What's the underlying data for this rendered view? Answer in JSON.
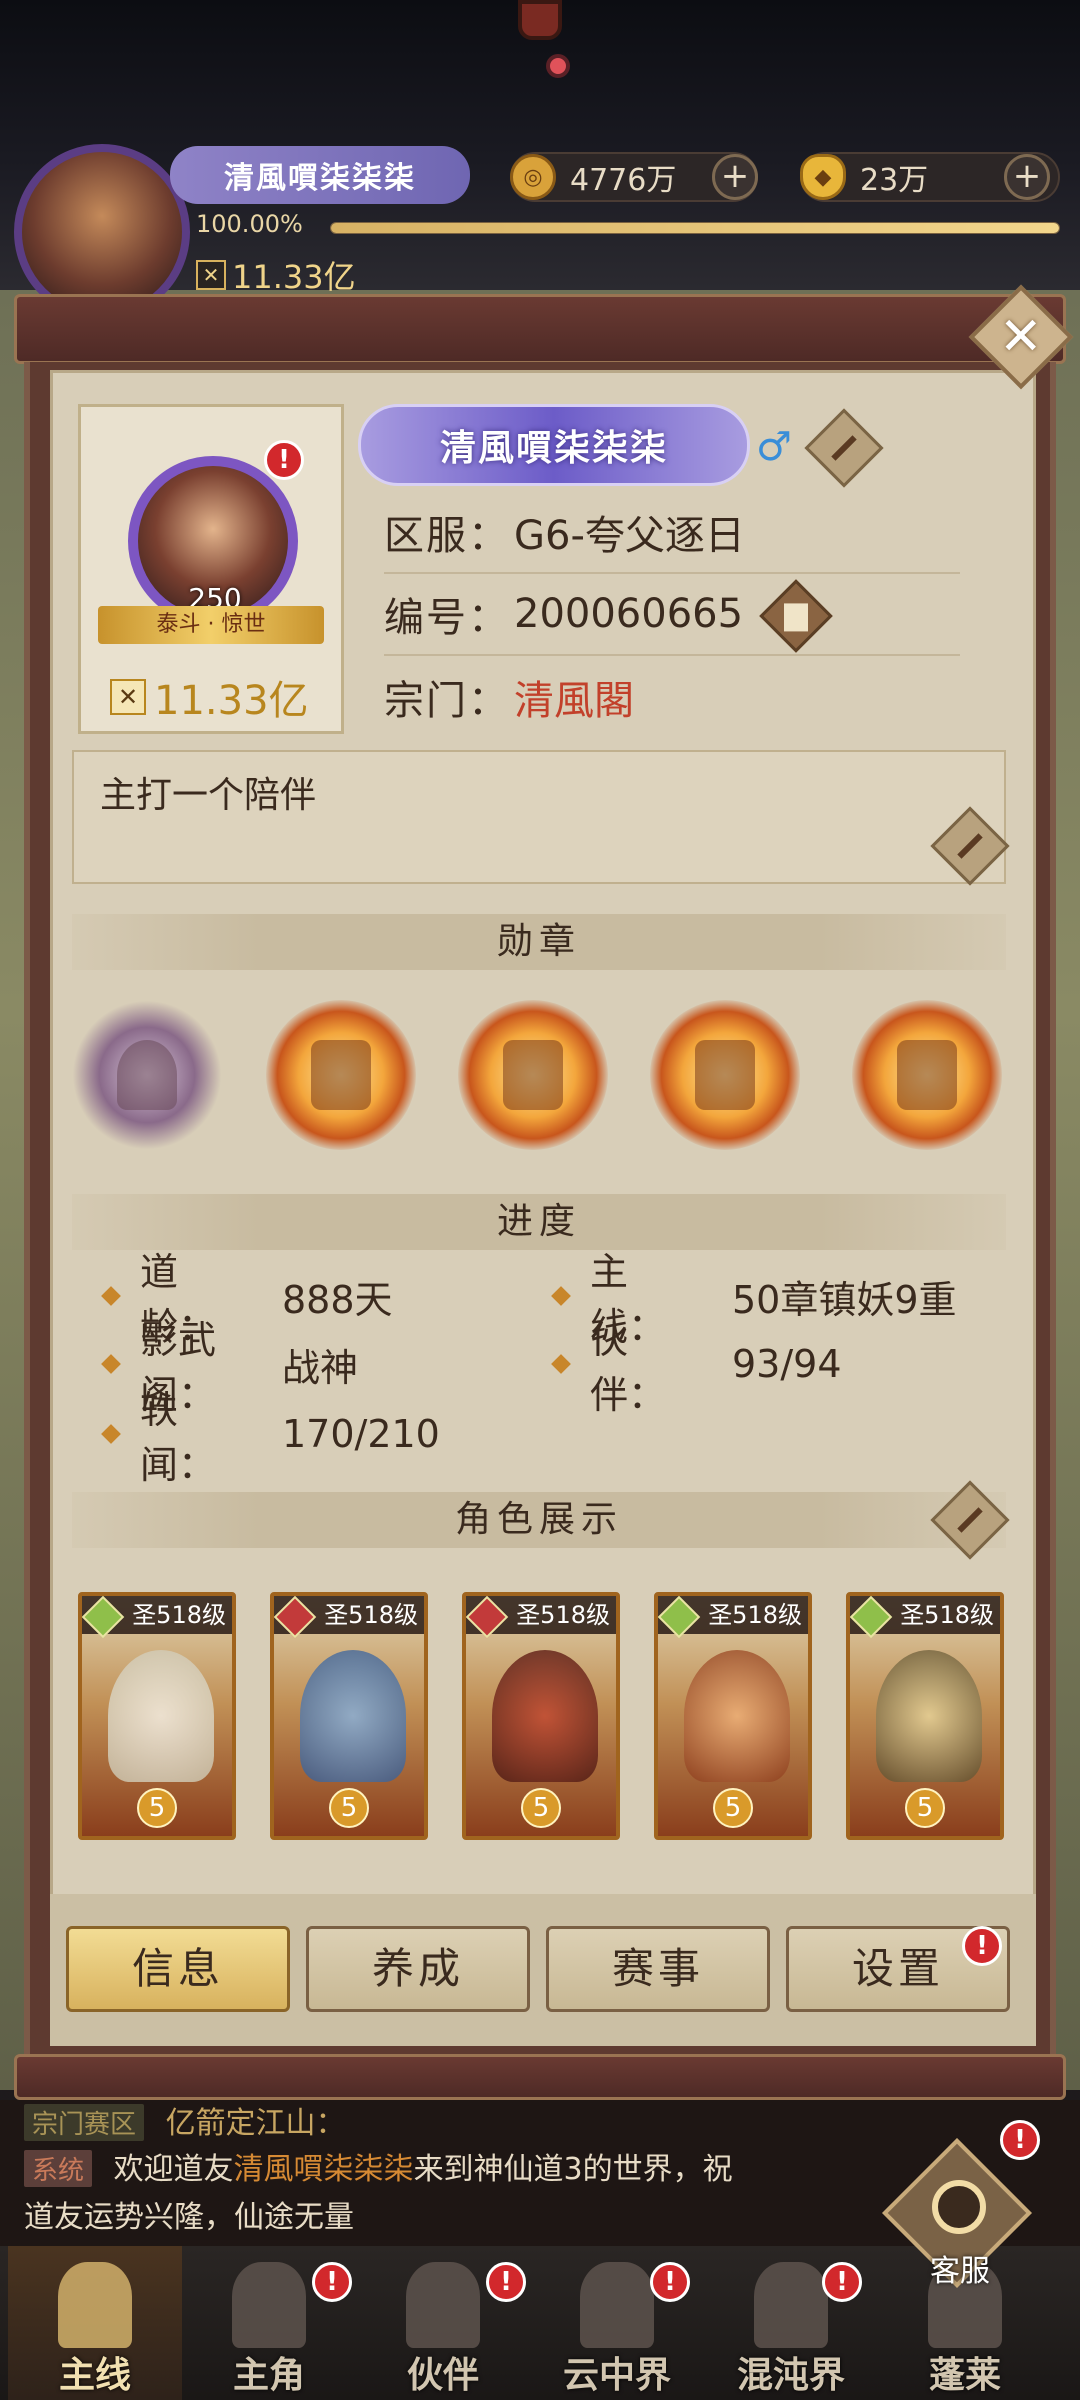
{
  "status": {
    "player_name": "清風嘪柒柒柒",
    "coins": "4776万",
    "ingots": "23万",
    "exp_percent_text": "100.00%",
    "exp_fill": 1.0,
    "power": "11.33亿"
  },
  "profile": {
    "name": "清風嘪柒柒柒",
    "gender_symbol": "♂",
    "avatar_level": "250",
    "avatar_title": "泰斗 · 惊世",
    "power": "11.33亿",
    "server_label": "区服：",
    "server_value": "G6-夸父逐日",
    "id_label": "编号：",
    "id_value": "200060665",
    "sect_label": "宗门：",
    "sect_value": "清風閣",
    "signature": "主打一个陪伴",
    "alert": "!"
  },
  "sections": {
    "medals": "勋章",
    "progress": "进度",
    "heroes": "角色展示"
  },
  "progress": [
    {
      "key": "道　龄：",
      "value": "888天"
    },
    {
      "key": "主　线：",
      "value": "50章镇妖9重"
    },
    {
      "key": "影武阁：",
      "value": "战神"
    },
    {
      "key": "伙　伴：",
      "value": "93/94"
    },
    {
      "key": "轶　闻：",
      "value": "170/210"
    }
  ],
  "heroes": [
    {
      "level": "圣518级",
      "stars": "5"
    },
    {
      "level": "圣518级",
      "stars": "5"
    },
    {
      "level": "圣518级",
      "stars": "5"
    },
    {
      "level": "圣518级",
      "stars": "5"
    },
    {
      "level": "圣518级",
      "stars": "5"
    }
  ],
  "tabs": [
    "信息",
    "养成",
    "赛事",
    "设置"
  ],
  "chat": {
    "line1_tag": "宗门赛区",
    "line1_text": "亿箭定江山：",
    "line2_tag": "系统",
    "line2_prefix": "欢迎道友",
    "line2_name": "清風嘪柒柒柒",
    "line2_suffix": "来到神仙道3的世界，祝",
    "line3_text": "道友运势兴隆，仙途无量"
  },
  "service_label": "客服",
  "bottom_nav": [
    "主线",
    "主角",
    "伙伴",
    "云中界",
    "混沌界",
    "蓬莱"
  ],
  "close_symbol": "✕",
  "colors": {
    "accent_gold": "#d8b25e",
    "sect_red": "#c2402a",
    "alert_red": "#d2282c"
  }
}
